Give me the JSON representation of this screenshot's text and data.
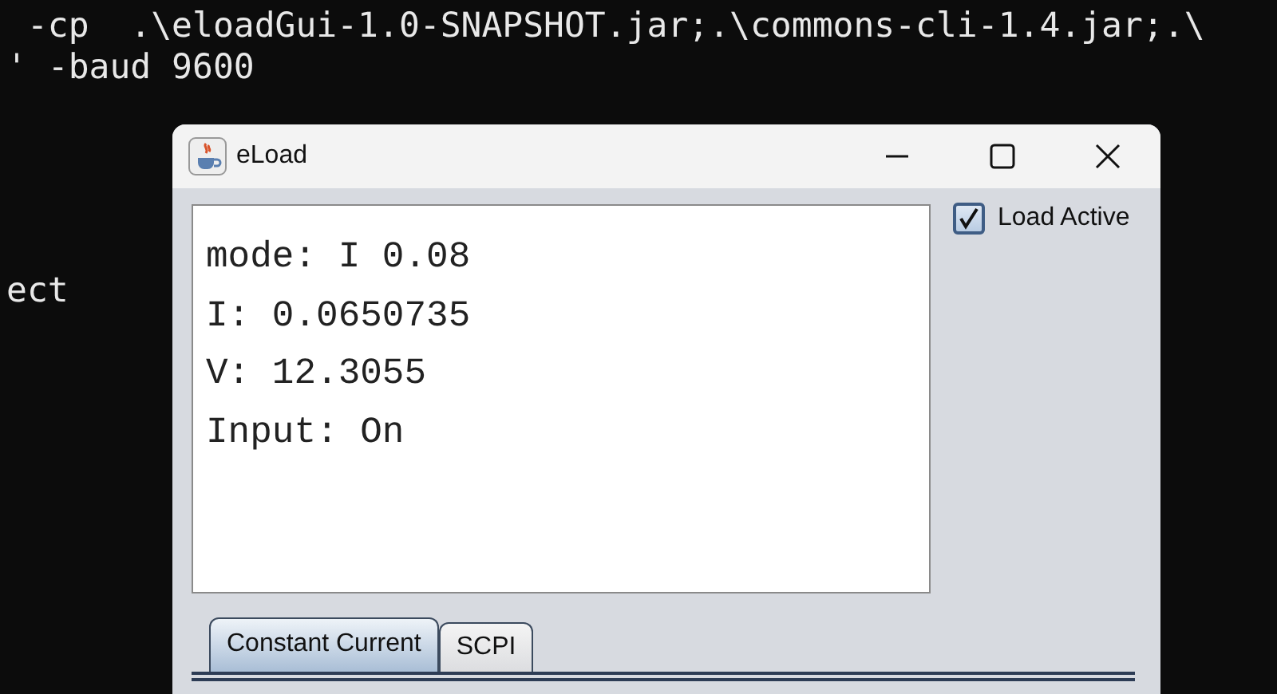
{
  "terminal": {
    "lines": [
      " -cp  .\\eloadGui-1.0-SNAPSHOT.jar;.\\commons-cli-1.4.jar;.\\",
      "' -baud 9600"
    ],
    "lower_fragment": "ect"
  },
  "window": {
    "title": "eLoad"
  },
  "display": {
    "lines": [
      "mode: I 0.08",
      "I: 0.0650735",
      "V: 12.3055",
      "Input: On"
    ]
  },
  "load_active": {
    "label": "Load Active",
    "checked": true
  },
  "tabs": [
    {
      "label": "Constant Current",
      "selected": true
    },
    {
      "label": "SCPI",
      "selected": false
    }
  ]
}
